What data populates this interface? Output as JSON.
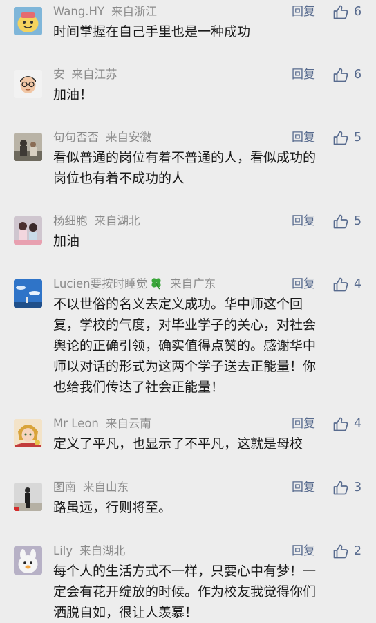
{
  "labels": {
    "reply": "回复"
  },
  "comments": [
    {
      "name": "Wang.HY",
      "location": "来自浙江",
      "likes": "6",
      "text": [
        "时间掌握在自己手里也是一种成功"
      ],
      "avatar": "cartoon-face"
    },
    {
      "name": "安",
      "location": "来自江苏",
      "likes": "6",
      "text": [
        "加油！"
      ],
      "avatar": "memoji-glasses"
    },
    {
      "name": "句句否否",
      "location": "来自安徽",
      "likes": "5",
      "text": [
        "看似普通的岗位有着不普通的人，看似成功的",
        "岗位也有着不成功的人"
      ],
      "avatar": "photo-people"
    },
    {
      "name": "杨细胞",
      "location": "来自湖北",
      "likes": "5",
      "text": [
        "加油"
      ],
      "avatar": "photo-two-girls"
    },
    {
      "name": "Lucien要按时睡觉",
      "location": "来自广东",
      "likes": "4",
      "name_icon": "four-leaf-clover",
      "text": [
        "不以世俗的名义去定义成功。华中师这个回",
        "复，学校的气度，对毕业学子的关心，对社会",
        "舆论的正确引领，确实值得点赞的。感谢华中",
        "师以对话的形式为这两个学子送去正能量！你",
        "也给我们传达了社会正能量！"
      ],
      "avatar": "photo-blue-sky"
    },
    {
      "name": "Mr Leon",
      "location": "来自云南",
      "likes": "4",
      "text": [
        "定义了平凡，也显示了不平凡，这就是母校"
      ],
      "avatar": "anime-character"
    },
    {
      "name": "图南",
      "location": "来自山东",
      "likes": "3",
      "text": [
        "路虽远，行则将至。"
      ],
      "avatar": "photo-person-flag"
    },
    {
      "name": "Lily",
      "location": "来自湖北",
      "likes": "2",
      "text": [
        "每个人的生活方式不一样，只要心中有梦！一",
        "定会有花开绽放的时候。作为校友我觉得你们",
        "洒脱自如，很让人羡慕！"
      ],
      "avatar": "cartoon-duck"
    }
  ],
  "colors": {
    "background": "#ededed",
    "meta": "#8a8a8a",
    "link": "#586b8e",
    "text": "#1a1a1a"
  }
}
